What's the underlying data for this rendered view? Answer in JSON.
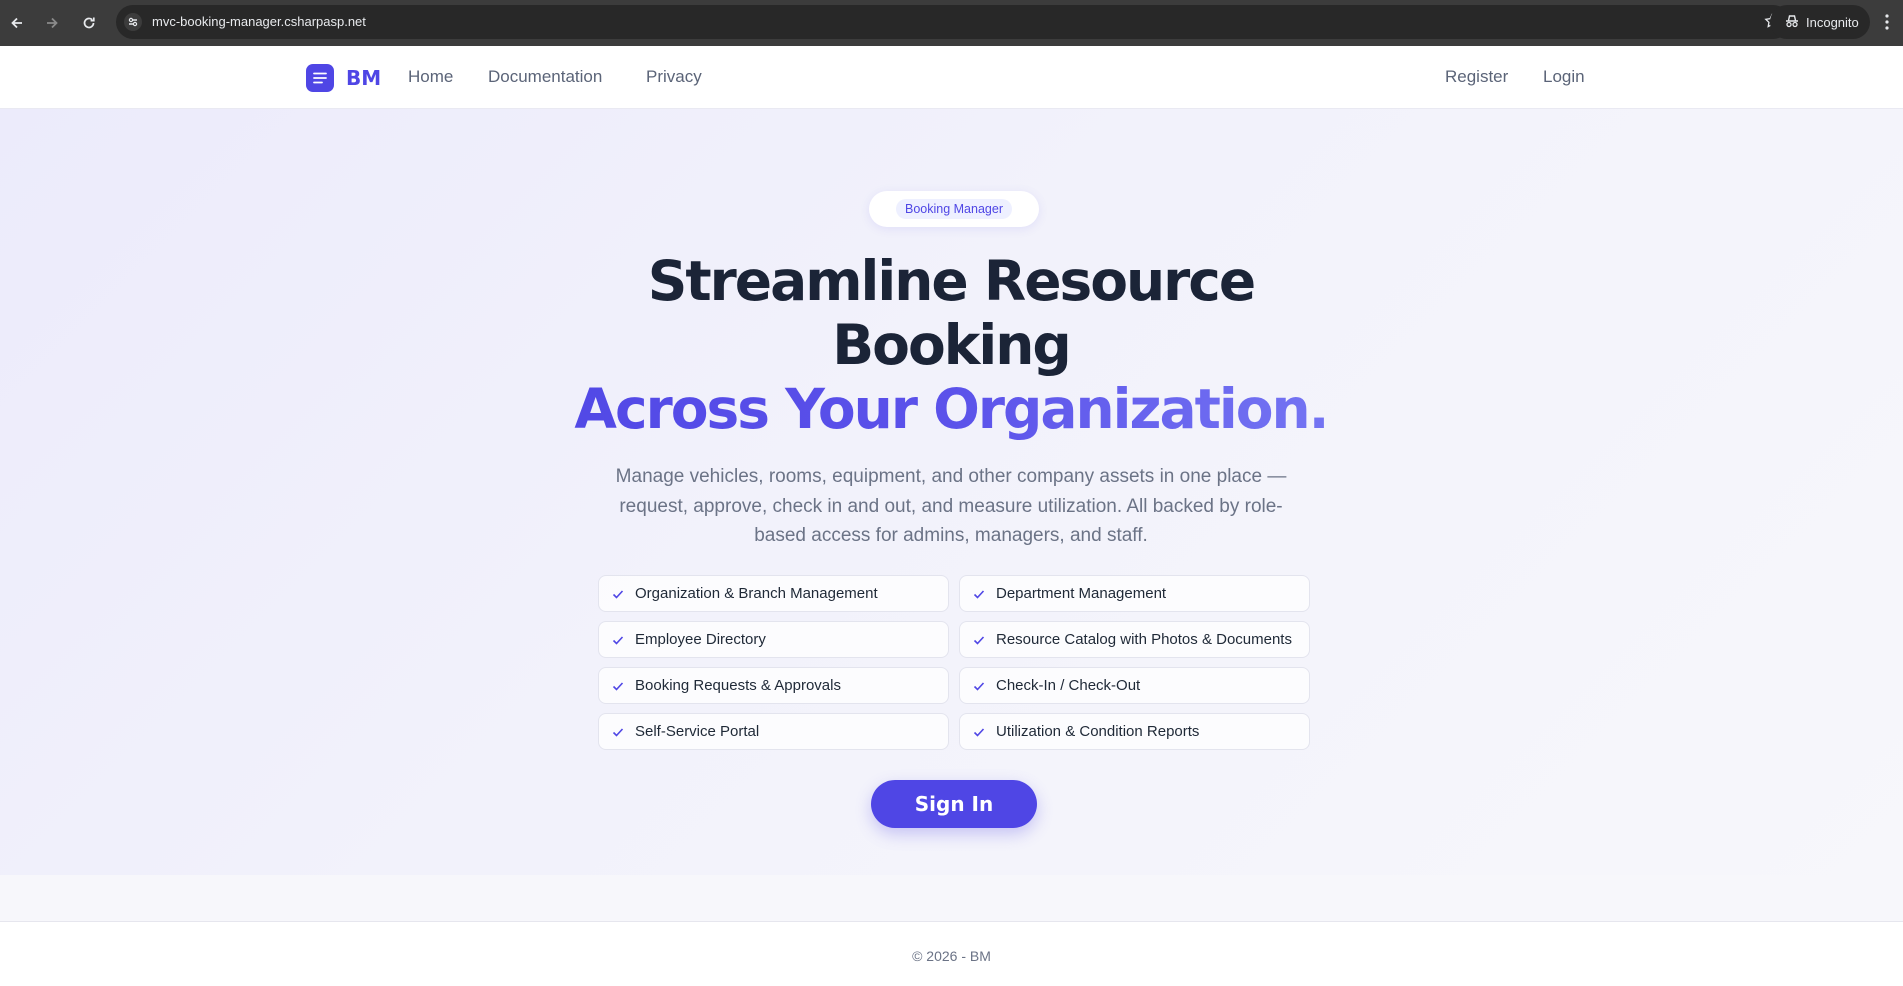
{
  "browser": {
    "url": "mvc-booking-manager.csharpasp.net",
    "incognito_label": "Incognito"
  },
  "navbar": {
    "brand": "BM",
    "links": [
      "Home",
      "Documentation",
      "Privacy"
    ],
    "auth_links": [
      "Register",
      "Login"
    ]
  },
  "hero": {
    "badge": "Booking Manager",
    "headline_line1": "Streamline Resource",
    "headline_line2": "Booking",
    "headline_accent": "Across Your Organization.",
    "lead": "Manage vehicles, rooms, equipment, and other company assets in one place — request, approve, check in and out, and measure utilization. All backed by role-based access for admins, managers, and staff.",
    "features": [
      "Organization & Branch Management",
      "Department Management",
      "Employee Directory",
      "Resource Catalog with Photos & Documents",
      "Booking Requests & Approvals",
      "Check-In / Check-Out",
      "Self-Service Portal",
      "Utilization & Condition Reports"
    ],
    "cta": "Sign In"
  },
  "footer": {
    "text": "© 2026 - BM"
  },
  "colors": {
    "accent": "#4f46e5",
    "heading": "#1b2437",
    "muted": "#6b7386"
  }
}
